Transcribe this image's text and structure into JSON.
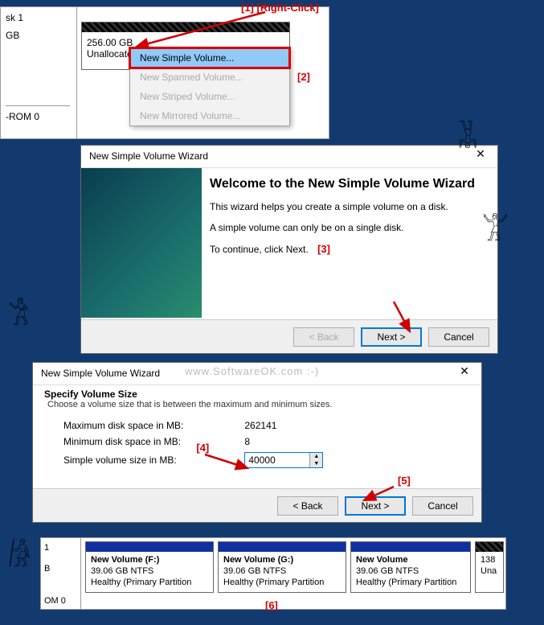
{
  "annotations": {
    "a1": "[1] [Right-Click]",
    "a2": "[2]",
    "a3": "[3]",
    "a4": "[4]",
    "a5": "[5]",
    "a6": "[6]"
  },
  "watermark": "www.SoftwareOK.com :-)",
  "disk_top": {
    "left_label_top": "sk 1",
    "left_label_size": "GB",
    "left_label_bottom": "-ROM 0",
    "unalloc_size": "256.00 GB",
    "unalloc_label": "Unallocate"
  },
  "context_menu": {
    "items": [
      {
        "label": "New Simple Volume...",
        "selected": true
      },
      {
        "label": "New Spanned Volume...",
        "selected": false
      },
      {
        "label": "New Striped Volume...",
        "selected": false
      },
      {
        "label": "New Mirrored Volume...",
        "selected": false
      }
    ]
  },
  "wizard1": {
    "title": "New Simple Volume Wizard",
    "heading": "Welcome to the New Simple Volume Wizard",
    "p1": "This wizard helps you create a simple volume on a disk.",
    "p2": "A simple volume can only be on a single disk.",
    "p3": "To continue, click Next.",
    "back": "< Back",
    "next": "Next >",
    "cancel": "Cancel"
  },
  "wizard2": {
    "title": "New Simple Volume Wizard",
    "heading": "Specify Volume Size",
    "sub": "Choose a volume size that is between the maximum and minimum sizes.",
    "rows": {
      "max_label": "Maximum disk space in MB:",
      "max_val": "262141",
      "min_label": "Minimum disk space in MB:",
      "min_val": "8",
      "size_label": "Simple volume size in MB:",
      "size_val": "40000"
    },
    "back": "< Back",
    "next": "Next >",
    "cancel": "Cancel"
  },
  "result": {
    "left1": "1",
    "left2": "B",
    "left3": "OM 0",
    "vols": [
      {
        "name": "New Volume  (F:)",
        "info": "39.06 GB NTFS",
        "status": "Healthy (Primary Partition"
      },
      {
        "name": "New Volume  (G:)",
        "info": "39.06 GB NTFS",
        "status": "Healthy (Primary Partition"
      },
      {
        "name": "New Volume",
        "info": "39.06 GB NTFS",
        "status": "Healthy (Primary Partition"
      }
    ],
    "tail": "138",
    "tail2": "Una"
  }
}
